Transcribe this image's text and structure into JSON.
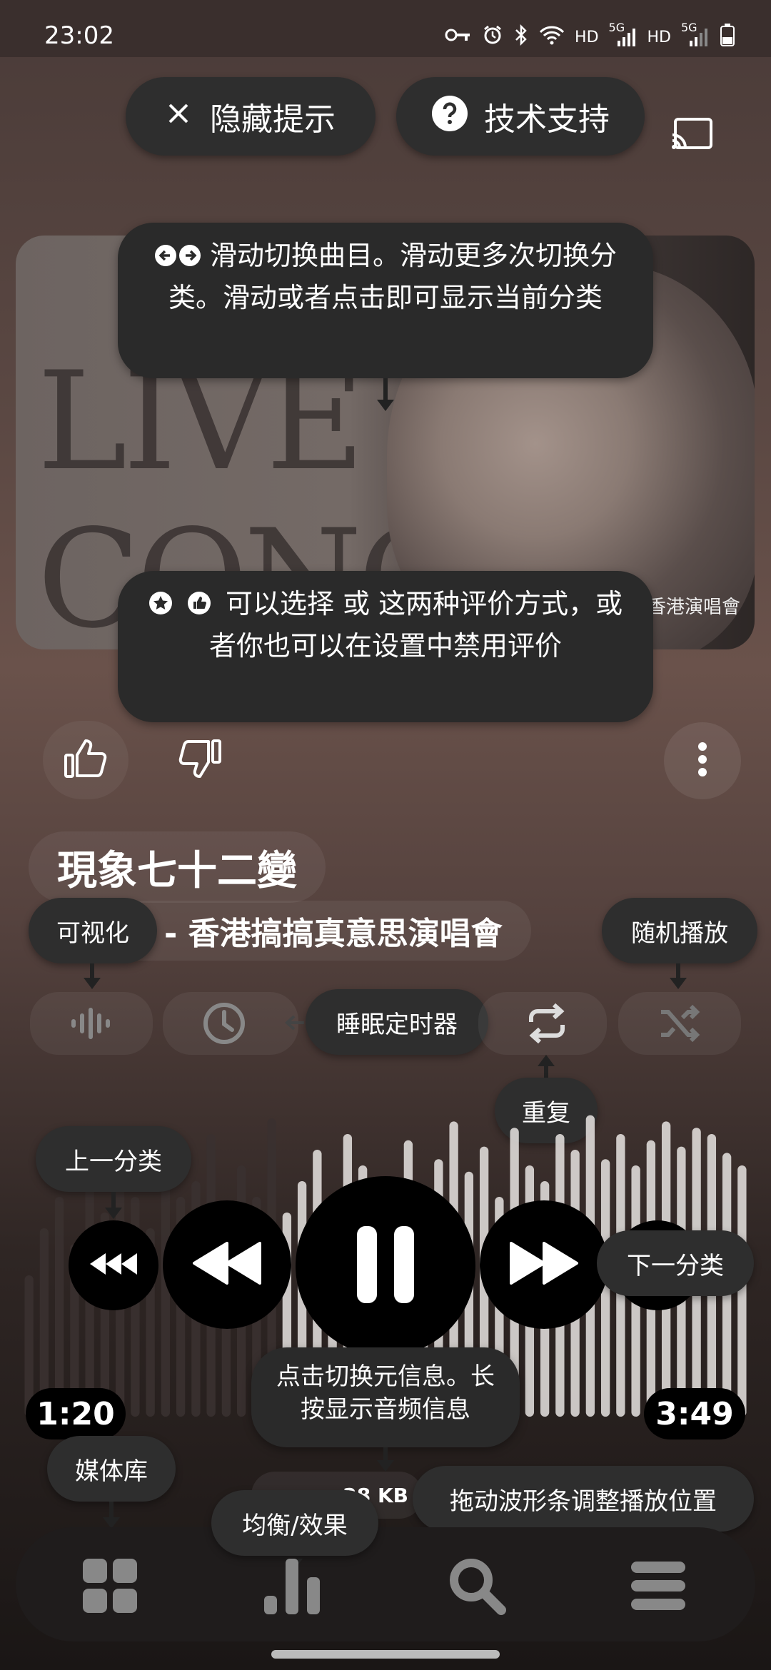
{
  "status_bar": {
    "time": "23:02",
    "net_labels": [
      "HD",
      "5G",
      "HD",
      "5G"
    ]
  },
  "hint_bar": {
    "hide_tips": "隐藏提示",
    "tech_support": "技术支持"
  },
  "tips": {
    "swipe": "滑动切换曲目。滑动更多次切换分类。滑动或者点击即可显示当前分类",
    "rating": "可以选择 或 这两种评价方式，或者你也可以在设置中禁用评价",
    "visualize": "可视化",
    "shuffle": "随机播放",
    "sleep_timer": "睡眠定时器",
    "repeat": "重复",
    "prev_category": "上一分类",
    "next_category": "下一分类",
    "metadata": "点击切换元信息。长按显示音频信息",
    "library": "媒体库",
    "equalizer": "均衡/效果",
    "drag_waveform": "拖动波形条调整播放位置"
  },
  "album_art": {
    "cover_text": "LIVE IN CONCERT",
    "cover_subtitle": "香港演唱會"
  },
  "track": {
    "title": "現象七十二變",
    "album": "- 香港搞搞真意思演唱會",
    "elapsed": "1:20",
    "duration": "3:49",
    "bitrate_partial": "28 KB"
  },
  "colors": {
    "pill_bg": "#2e2e2e",
    "waveform_played": "#3a3130",
    "waveform_unplayed": "#e8e4e2"
  }
}
